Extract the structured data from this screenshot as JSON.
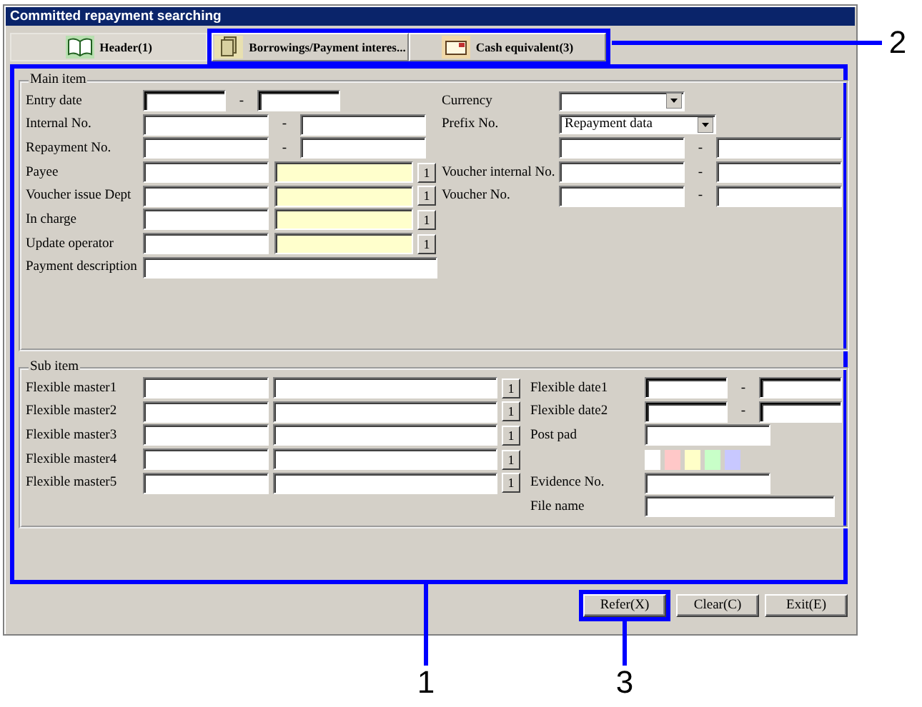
{
  "window": {
    "title": "Committed repayment searching"
  },
  "tabs": [
    {
      "label": "Header(1)",
      "selected": true
    },
    {
      "label": "Borrowings/Payment interes...",
      "selected": false
    },
    {
      "label": "Cash equivalent(3)",
      "selected": false
    }
  ],
  "main_item": {
    "title": "Main item",
    "left_rows": [
      {
        "kind": "date_range",
        "label": "Entry date",
        "separator": "-"
      },
      {
        "kind": "range",
        "label": "Internal No.",
        "separator": "-"
      },
      {
        "kind": "range",
        "label": "Repayment No.",
        "separator": "-"
      },
      {
        "kind": "lookup",
        "label": "Payee",
        "button": "1"
      },
      {
        "kind": "lookup",
        "label": "Voucher issue Dept",
        "button": "1"
      },
      {
        "kind": "lookup",
        "label": "In charge",
        "button": "1"
      },
      {
        "kind": "lookup",
        "label": "Update operator",
        "button": "1"
      },
      {
        "kind": "text_wide",
        "label": "Payment description"
      }
    ],
    "right_rows": [
      {
        "kind": "combo",
        "label": "Currency"
      },
      {
        "kind": "combo_wide",
        "label": "Prefix No.",
        "value": "Repayment data"
      },
      {
        "kind": "range",
        "separator": "-"
      },
      {
        "kind": "range",
        "label": "Voucher internal No.",
        "separator": "-"
      },
      {
        "kind": "range",
        "label": "Voucher No.",
        "separator": "-"
      }
    ]
  },
  "sub_item": {
    "title": "Sub item",
    "left_rows": [
      {
        "kind": "lookup_wide",
        "label": "Flexible master1",
        "button": "1"
      },
      {
        "kind": "lookup_wide",
        "label": "Flexible master2",
        "button": "1"
      },
      {
        "kind": "lookup_wide",
        "label": "Flexible master3",
        "button": "1"
      },
      {
        "kind": "lookup_wide",
        "label": "Flexible master4",
        "button": "1"
      },
      {
        "kind": "lookup_wide",
        "label": "Flexible master5",
        "button": "1"
      }
    ],
    "right_rows": [
      {
        "kind": "date_range",
        "label": "Flexible date1",
        "separator": "-"
      },
      {
        "kind": "date_range",
        "label": "Flexible date2",
        "separator": "-"
      },
      {
        "kind": "text",
        "label": "Post pad"
      },
      {
        "kind": "swatches",
        "swatches": [
          {
            "color": "#ffffff"
          },
          {
            "color": "#ffc8c8"
          },
          {
            "color": "#ffffc8"
          },
          {
            "color": "#c8ffc8"
          },
          {
            "color": "#c8c8ff"
          }
        ]
      },
      {
        "kind": "text",
        "label": "Evidence No."
      },
      {
        "kind": "text_long",
        "label": "File name"
      }
    ]
  },
  "buttons": [
    {
      "label": "Refer(X)"
    },
    {
      "label": "Clear(C)"
    },
    {
      "label": "Exit(E)"
    }
  ],
  "callouts": [
    {
      "number": "1"
    },
    {
      "number": "2"
    },
    {
      "number": "3"
    }
  ]
}
